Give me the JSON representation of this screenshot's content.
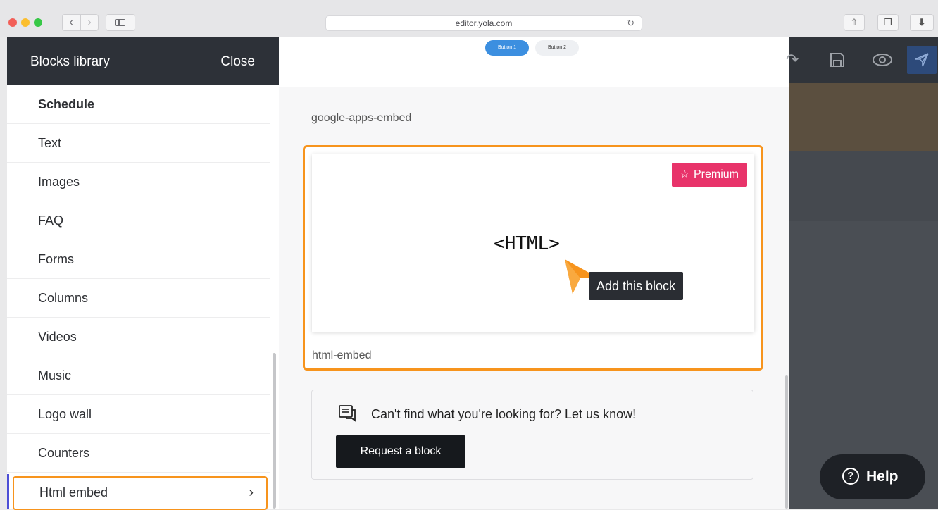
{
  "browser": {
    "url": "editor.yola.com",
    "back_icon": "chevron-left-icon",
    "forward_icon": "chevron-right-icon",
    "sidebar_icon": "sidebar-icon",
    "reload_icon": "reload-icon",
    "share_icon": "share-icon",
    "tabs_icon": "tabs-icon",
    "download_icon": "download-icon"
  },
  "sidebar": {
    "title": "Blocks library",
    "close_label": "Close",
    "items": [
      {
        "label": "Schedule"
      },
      {
        "label": "Text"
      },
      {
        "label": "Images"
      },
      {
        "label": "FAQ"
      },
      {
        "label": "Forms"
      },
      {
        "label": "Columns"
      },
      {
        "label": "Videos"
      },
      {
        "label": "Music"
      },
      {
        "label": "Logo wall"
      },
      {
        "label": "Counters"
      },
      {
        "label": "Html embed",
        "active": true
      }
    ],
    "accent_color": "#f7941d"
  },
  "main": {
    "preview_buttons": [
      "Button 1",
      "Button 2"
    ],
    "prev_block_label": "google-apps-embed",
    "block": {
      "badge": "Premium",
      "code_text": "<HTML>",
      "tooltip": "Add this block",
      "caption": "html-embed"
    },
    "request": {
      "text": "Can't find what you're looking for? Let us know!",
      "button": "Request a block"
    }
  },
  "editor": {
    "help_label": "Help",
    "toolbar_icons": [
      "redo-icon",
      "save-icon",
      "preview-eye-icon",
      "publish-rocket-icon"
    ]
  },
  "colors": {
    "premium": "#e8336a",
    "highlight": "#f7941d",
    "primary_button": "#3c8fe0",
    "dark": "#2d3138"
  }
}
